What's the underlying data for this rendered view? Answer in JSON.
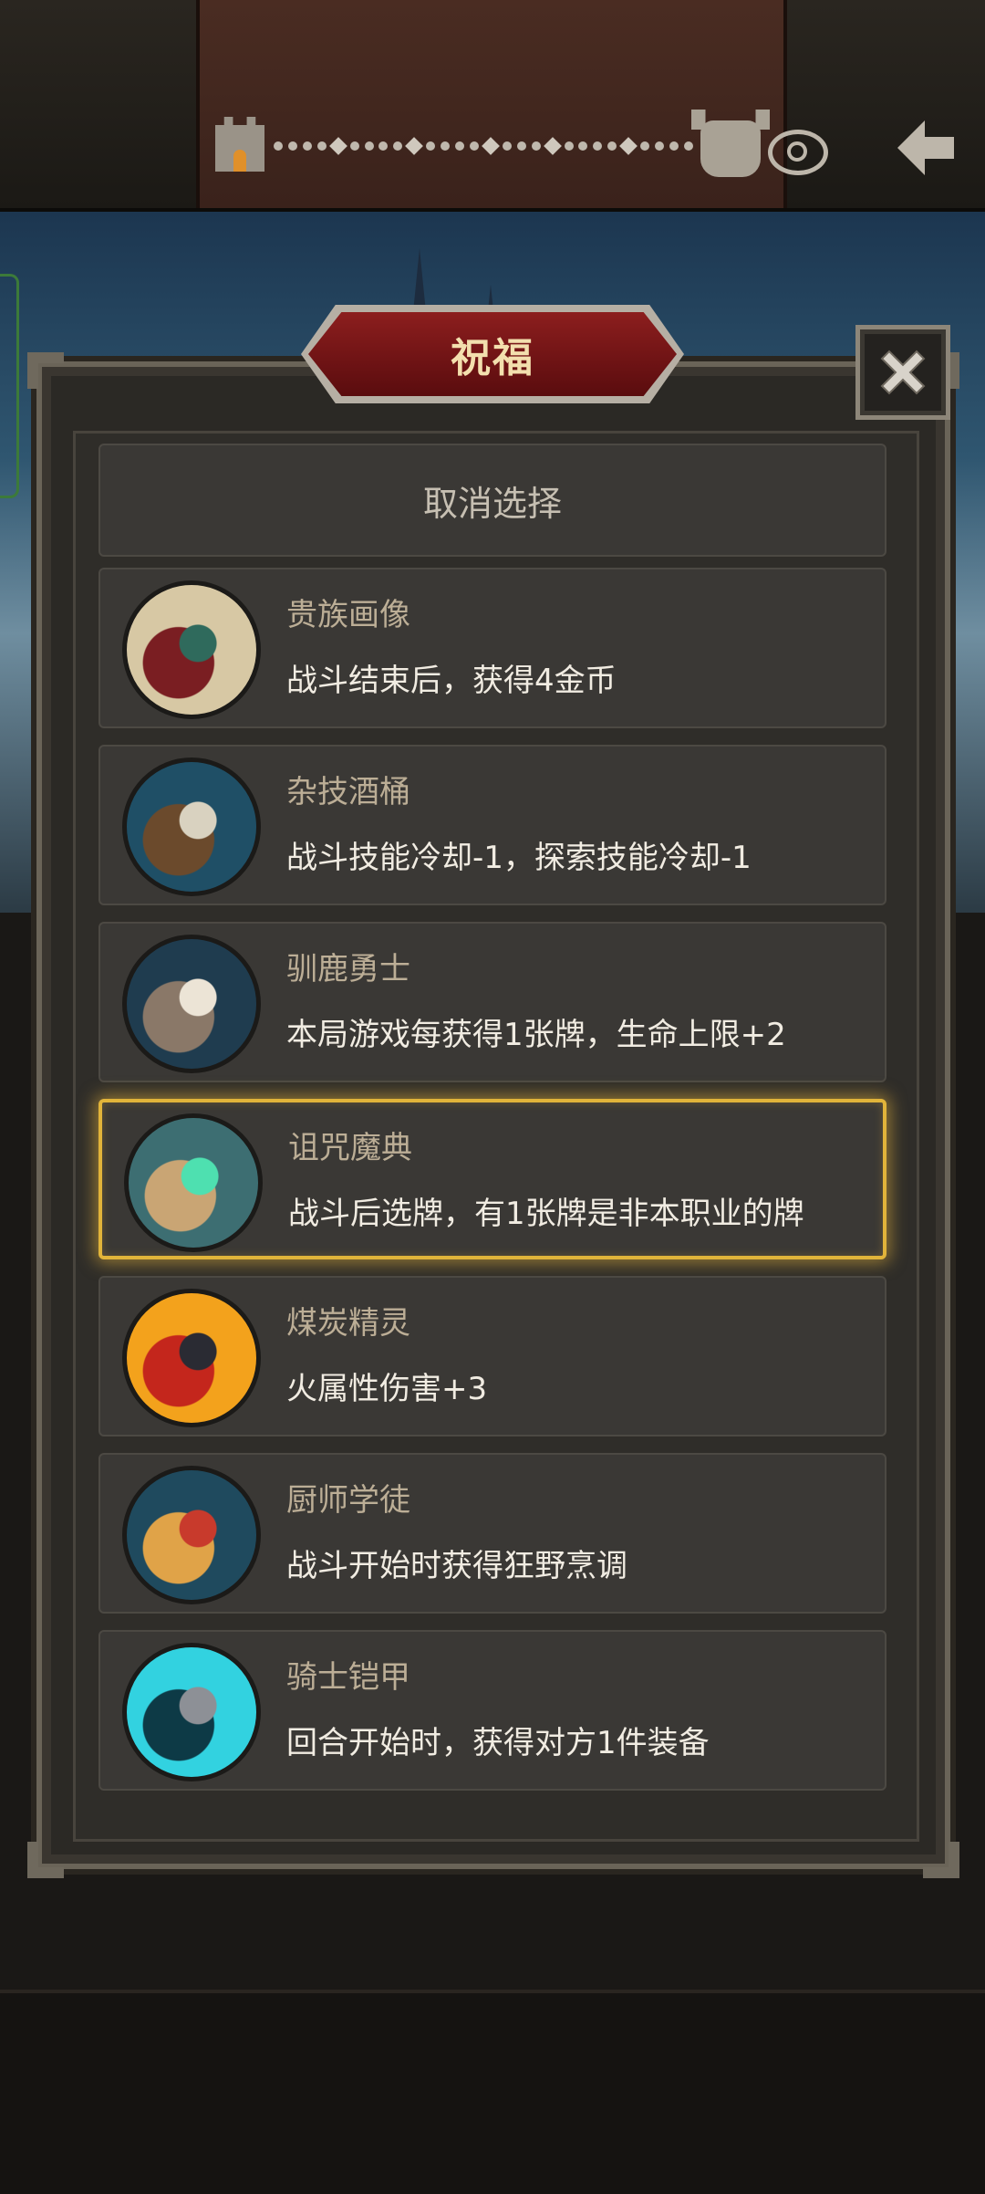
{
  "header": {
    "path_nodes": [
      "dot",
      "dot",
      "dot",
      "dot",
      "diamond",
      "dot",
      "dot",
      "dot",
      "dot",
      "diamond",
      "dot",
      "dot",
      "dot",
      "dot",
      "diamond",
      "dot",
      "dot",
      "dot",
      "diamond",
      "dot",
      "dot",
      "dot",
      "dot",
      "diamond",
      "dot",
      "dot",
      "dot",
      "dot"
    ]
  },
  "dialog": {
    "title": "祝福",
    "cancel_label": "取消选择",
    "items": [
      {
        "name": "贵族画像",
        "desc": "战斗结束后，获得4金币",
        "selected": false,
        "colors": [
          "#d7c8a4",
          "#7a1e22",
          "#2f6a5c"
        ]
      },
      {
        "name": "杂技酒桶",
        "desc": "战斗技能冷却-1，探索技能冷却-1",
        "selected": false,
        "colors": [
          "#1f4f66",
          "#6b4a2c",
          "#d9d2c0"
        ]
      },
      {
        "name": "驯鹿勇士",
        "desc": "本局游戏每获得1张牌，生命上限+2",
        "selected": false,
        "colors": [
          "#1f3c4f",
          "#8a7868",
          "#ece4d6"
        ]
      },
      {
        "name": "诅咒魔典",
        "desc": "战斗后选牌，有1张牌是非本职业的牌",
        "selected": true,
        "colors": [
          "#3d6e72",
          "#c9a574",
          "#4ee0b0"
        ]
      },
      {
        "name": "煤炭精灵",
        "desc": "火属性伤害+3",
        "selected": false,
        "colors": [
          "#f3a21c",
          "#c4261c",
          "#2a2b33"
        ]
      },
      {
        "name": "厨师学徒",
        "desc": "战斗开始时获得狂野烹调",
        "selected": false,
        "colors": [
          "#1f4a5e",
          "#e0a348",
          "#c83a2c"
        ]
      },
      {
        "name": "骑士铠甲",
        "desc": "回合开始时，获得对方1件装备",
        "selected": false,
        "colors": [
          "#32d2e0",
          "#0d3a46",
          "#8d9096"
        ]
      }
    ]
  }
}
